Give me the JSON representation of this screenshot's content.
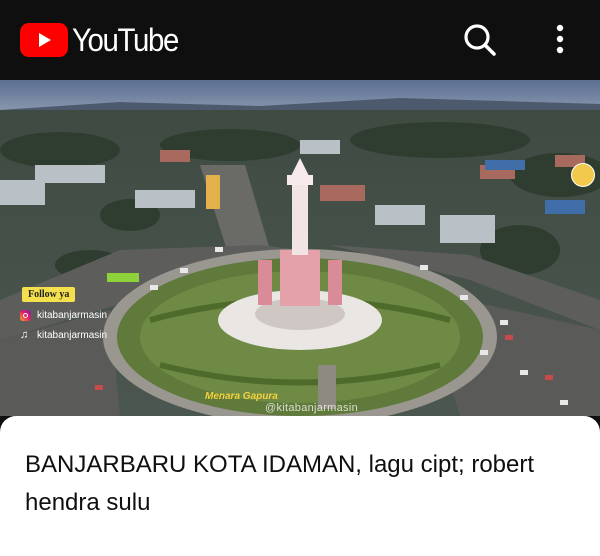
{
  "app": {
    "name": "YouTube",
    "brand_color": "#ff0000",
    "icons": {
      "logo": "youtube-play-icon",
      "search": "search-icon",
      "more": "more-vertical-icon"
    }
  },
  "video": {
    "overlay": {
      "follow_label": "Follow ya",
      "instagram_handle": "kitabanjarmasin",
      "tiktok_handle": "kitabanjarmasin",
      "location_caption": "Menara Gapura",
      "watermark": "@kitabanjarmasin"
    }
  },
  "info": {
    "title": "BANJARBARU KOTA IDAMAN, lagu cipt; robert hendra sulu"
  }
}
